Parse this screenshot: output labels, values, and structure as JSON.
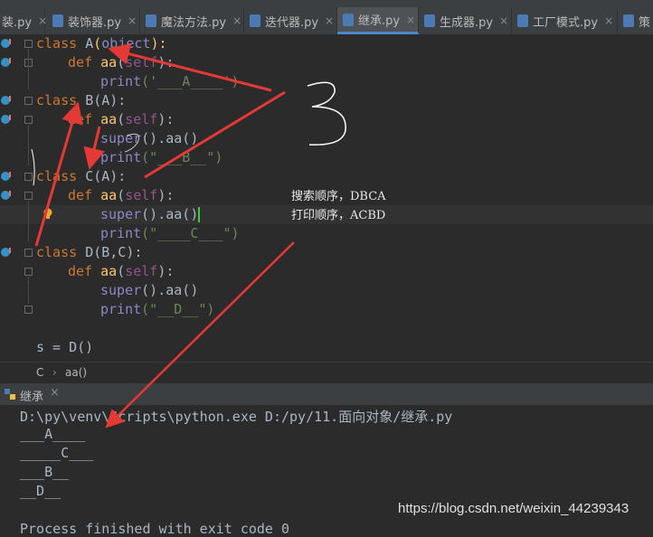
{
  "tabs": [
    {
      "label": "装.py",
      "active": false
    },
    {
      "label": "装饰器.py",
      "active": false
    },
    {
      "label": "魔法方法.py",
      "active": false
    },
    {
      "label": "迭代器.py",
      "active": false
    },
    {
      "label": "继承.py",
      "active": true
    },
    {
      "label": "生成器.py",
      "active": false
    },
    {
      "label": "工厂模式.py",
      "active": false
    },
    {
      "label": "策",
      "active": false
    }
  ],
  "code": {
    "l1": {
      "kw": "class",
      "name": "A",
      "paren": "(",
      "base": "object",
      "end": "):"
    },
    "l2": {
      "kw": "def",
      "name": "aa",
      "paren": "(",
      "self": "self",
      "end": "):"
    },
    "l3": {
      "fn": "print",
      "arg": "('___A____')"
    },
    "l4": {
      "kw": "class",
      "name": "B",
      "rest": "(A):"
    },
    "l5": {
      "kw": "def",
      "name": "aa",
      "paren": "(",
      "self": "self",
      "end": "):"
    },
    "l6": {
      "fn": "super",
      "rest": "().aa()"
    },
    "l7": {
      "fn": "print",
      "arg": "(\"___B__\")"
    },
    "l8": {
      "kw": "class",
      "name": "C",
      "rest": "(A):"
    },
    "l9": {
      "kw": "def",
      "name": "aa",
      "paren": "(",
      "self": "self",
      "end": "):"
    },
    "l10": {
      "fn": "super",
      "rest": "().aa()"
    },
    "l11": {
      "fn": "print",
      "arg": "(\"____C___\")"
    },
    "l12": {
      "kw": "class",
      "name": "D",
      "rest": "(B,C):"
    },
    "l13": {
      "kw": "def",
      "name": "aa",
      "paren": "(",
      "self": "self",
      "end": "):"
    },
    "l14": {
      "fn": "super",
      "rest": "().aa()"
    },
    "l15": {
      "fn": "print",
      "arg": "(\"__D__\")"
    },
    "l16": {
      "text": "s = D()"
    }
  },
  "notes": {
    "search_order": "搜索顺序，DBCA",
    "print_order": "打印顺序，ACBD"
  },
  "breadcrumb": {
    "class": "C",
    "sep": "›",
    "method": "aa()"
  },
  "run_panel": {
    "tab_label": "继承",
    "close": "×"
  },
  "console": {
    "command": "D:\\py\\venv\\Scripts\\python.exe D:/py/11.面向对象/继承.py",
    "out": [
      "___A____",
      "_____C___",
      "___B__",
      "__D__"
    ],
    "exit": "Process finished with exit code 0"
  },
  "watermark": "https://blog.csdn.net/weixin_44239343",
  "annotation_number": "3",
  "colors": {
    "arrow": "#e53935",
    "keyword": "#cc7832",
    "string": "#6a8759",
    "self": "#94558d",
    "function": "#ffc66d",
    "active_tab": "#4e5254"
  },
  "icons": {
    "tab_file": "python-file-icon",
    "gutter": "override-icon",
    "breakpoint": "bulb-icon",
    "run": "python-run-icon"
  }
}
